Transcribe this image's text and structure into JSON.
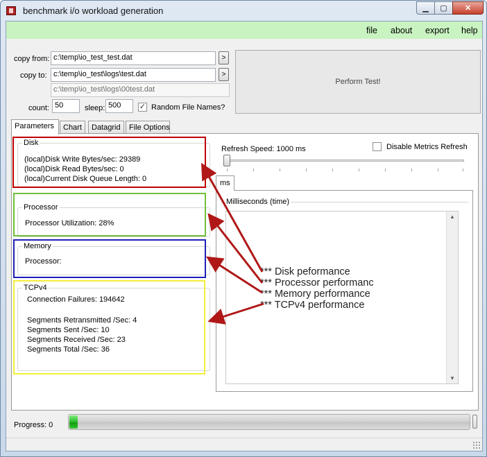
{
  "window": {
    "title": "benchmark i/o workload generation",
    "minimize_glyph": "▁",
    "maximize_glyph": "▢",
    "close_glyph": "✕"
  },
  "menu": [
    "file",
    "about",
    "export",
    "help"
  ],
  "form": {
    "copy_from_label": "copy from:",
    "copy_from_value": "c:\\temp\\io_test_test.dat",
    "copy_to_label": "copy to:",
    "copy_to_value": "c:\\temp\\io_test\\logs\\test.dat",
    "derived_path": "c:\\temp\\io_test\\logs\\00test.dat",
    "browse_glyph": ">",
    "count_label": "count:",
    "count_value": "50",
    "sleep_label": "sleep:",
    "sleep_value": "500",
    "random_names_label": "Random File Names?",
    "random_names_checked": true,
    "check_glyph": "✓",
    "perform_button": "Perform Test!"
  },
  "tabs": [
    "Parameters",
    "Chart",
    "Datagrid",
    "File Options"
  ],
  "groups": {
    "disk": {
      "title": "Disk",
      "lines": [
        "(local)Disk Write Bytes/sec: 29389",
        "(local)Disk Read Bytes/sec: 0",
        "(local)Current Disk Queue Length: 0"
      ]
    },
    "processor": {
      "title": "Processor",
      "lines": [
        "Processor Utilization: 28%"
      ]
    },
    "memory": {
      "title": "Memory",
      "lines": [
        "Processor:"
      ]
    },
    "tcp": {
      "title": "TCPv4",
      "lines": [
        "Connection Failures: 194642",
        "",
        "Segments Retransmitted /Sec: 4",
        "Segments Sent /Sec: 10",
        "Segments Received /Sec: 23",
        "Segments Total /Sec: 36"
      ]
    }
  },
  "refresh": {
    "label": "Refresh Speed: 1000 ms",
    "disable_label": "Disable Metrics Refresh",
    "disable_checked": false,
    "slider_position": 0.0
  },
  "ms_panel": {
    "tab": "ms",
    "group_title": "Milliseconds (time)",
    "scroll_up": "▲",
    "scroll_down": "▼"
  },
  "annotations": [
    "*** Disk peformance",
    "*** Processor performanc",
    "*** Memory performance",
    "*** TCPv4 performance"
  ],
  "progress": {
    "label": "Progress: 0",
    "fraction": 0.02
  },
  "colors": {
    "menubar": "#c9f3c1",
    "disk": "#c00000",
    "processor": "#6fbf3a",
    "memory": "#1f1fb8",
    "tcp": "#f2ee3a",
    "arrow": "#b01818"
  }
}
